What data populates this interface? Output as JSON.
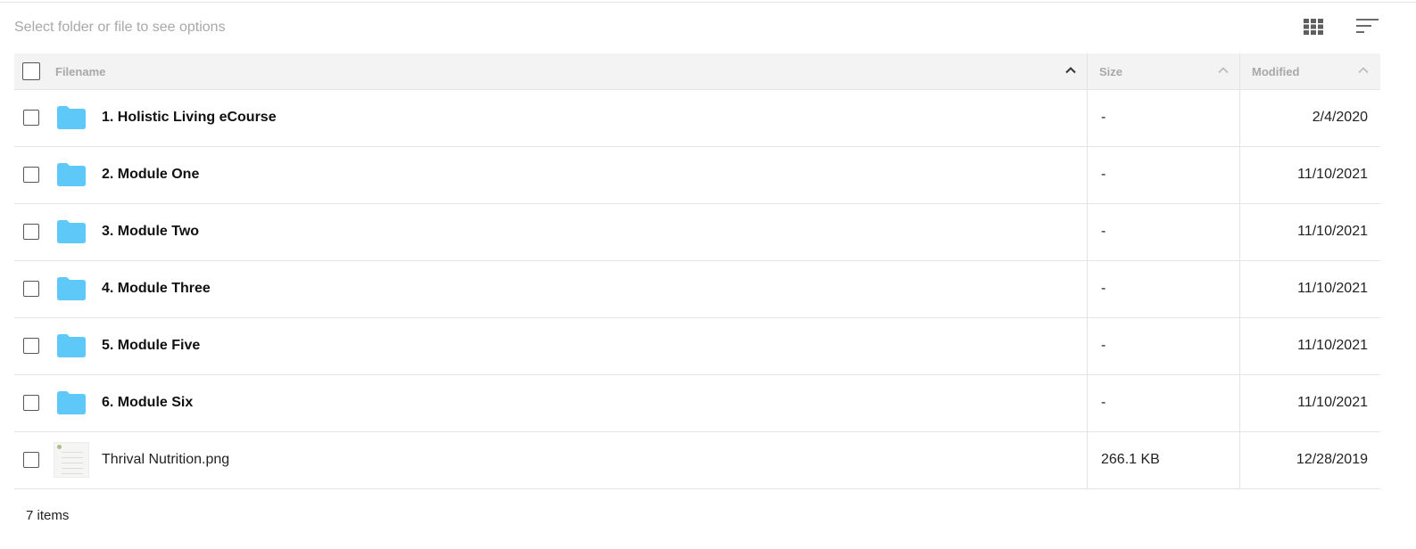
{
  "toolbar": {
    "hint": "Select folder or file to see options",
    "grid_view_icon": "grid-view-icon",
    "sort_icon": "sort-lines-icon"
  },
  "columns": {
    "filename": "Filename",
    "size": "Size",
    "modified": "Modified"
  },
  "rows": [
    {
      "type": "folder",
      "name": "1. Holistic Living eCourse",
      "size": "-",
      "modified": "2/4/2020"
    },
    {
      "type": "folder",
      "name": "2. Module One",
      "size": "-",
      "modified": "11/10/2021"
    },
    {
      "type": "folder",
      "name": "3. Module Two",
      "size": "-",
      "modified": "11/10/2021"
    },
    {
      "type": "folder",
      "name": "4. Module Three",
      "size": "-",
      "modified": "11/10/2021"
    },
    {
      "type": "folder",
      "name": "5. Module Five",
      "size": "-",
      "modified": "11/10/2021"
    },
    {
      "type": "folder",
      "name": "6. Module Six",
      "size": "-",
      "modified": "11/10/2021"
    },
    {
      "type": "file",
      "name": "Thrival Nutrition.png",
      "size": "266.1 KB",
      "modified": "12/28/2019"
    }
  ],
  "footer": {
    "count": "7 items"
  },
  "colors": {
    "folder": "#5ec8f8",
    "header_bg": "#f3f3f3",
    "hint_text": "#a8a8a8"
  }
}
